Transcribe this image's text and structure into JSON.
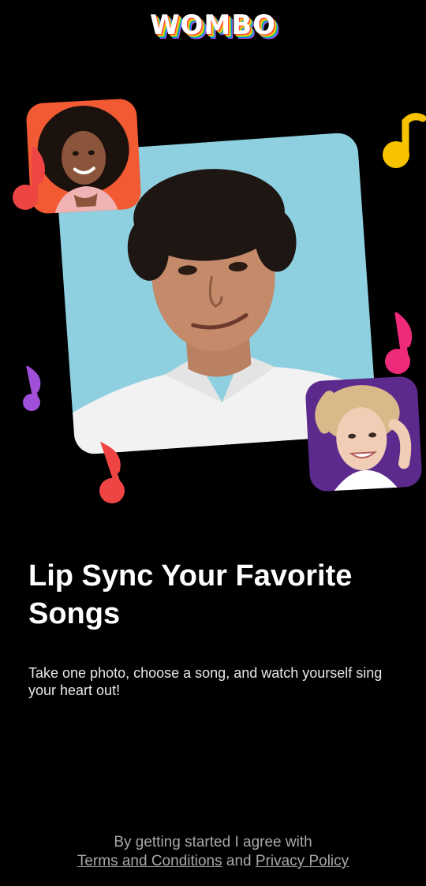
{
  "app": {
    "logo_text": "WOMBO"
  },
  "onboarding": {
    "title": "Lip Sync Your Favorite Songs",
    "subtitle": "Take one photo, choose a song, and watch yourself sing your heart out!"
  },
  "legal": {
    "prefix": "By getting started I agree with",
    "terms_label": "Terms and Conditions",
    "conjunction": "and",
    "privacy_label": "Privacy Policy"
  },
  "colors": {
    "background": "#000000",
    "note_yellow": "#f7c300",
    "note_pink": "#ee2a7b",
    "note_purple": "#a04fd8",
    "note_red": "#ee4444",
    "photo_blue": "#8ecfe0",
    "photo_orange": "#f25a33",
    "photo_purple": "#5b2a8c"
  },
  "icons": [
    "music-note-icon"
  ]
}
